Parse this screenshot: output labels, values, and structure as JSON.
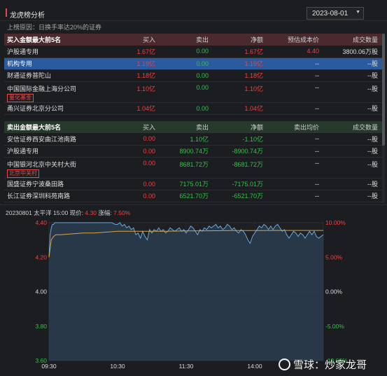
{
  "panel": {
    "title": "龙虎榜分析"
  },
  "date_picker": {
    "value": "2023-08-01"
  },
  "reason": "上榜原因：日换手率达20%的证券",
  "buy_table": {
    "headers": [
      "买入金额最大前5名",
      "买入",
      "卖出",
      "净额",
      "预估成本价",
      "成交数量"
    ],
    "rows": [
      {
        "name": "沪股通专用",
        "buy": "1.67亿",
        "sell": "0.00",
        "net": "1.67亿",
        "price": "4.40",
        "qty": "3800.06万股",
        "tag": "",
        "selected": false
      },
      {
        "name": "机构专用",
        "buy": "1.19亿",
        "sell": "0.00",
        "net": "1.19亿",
        "price": "--",
        "qty": "--股",
        "tag": "",
        "selected": true
      },
      {
        "name": "财通证券普陀山",
        "buy": "1.18亿",
        "sell": "0.00",
        "net": "1.18亿",
        "price": "--",
        "qty": "--股",
        "tag": "",
        "selected": false
      },
      {
        "name": "中国国际金融上海分公司",
        "buy": "1.10亿",
        "sell": "0.00",
        "net": "1.10亿",
        "price": "--",
        "qty": "--股",
        "tag": "量化基金",
        "selected": false
      },
      {
        "name": "甬兴证券北京分公司",
        "buy": "1.04亿",
        "sell": "0.00",
        "net": "1.04亿",
        "price": "--",
        "qty": "--股",
        "tag": "",
        "selected": false
      }
    ]
  },
  "sell_table": {
    "headers": [
      "卖出金额最大前5名",
      "买入",
      "卖出",
      "净额",
      "卖出均价",
      "成交数量"
    ],
    "rows": [
      {
        "name": "安信证券西安曲江池南路",
        "buy": "0.00",
        "sell": "1.10亿",
        "net": "-1.10亿",
        "price": "--",
        "qty": "--股",
        "tag": ""
      },
      {
        "name": "沪股通专用",
        "buy": "0.00",
        "sell": "8900.74万",
        "net": "-8900.74万",
        "price": "--",
        "qty": "--股",
        "tag": ""
      },
      {
        "name": "中国银河北京中关村大街",
        "buy": "0.00",
        "sell": "8681.72万",
        "net": "-8681.72万",
        "price": "--",
        "qty": "--股",
        "tag": "北京中关村"
      },
      {
        "name": "国盛证券宁波桑田路",
        "buy": "0.00",
        "sell": "7175.01万",
        "net": "-7175.01万",
        "price": "--",
        "qty": "--股",
        "tag": ""
      },
      {
        "name": "长江证券深圳科苑南路",
        "buy": "0.00",
        "sell": "6521.70万",
        "net": "-6521.70万",
        "price": "--",
        "qty": "--股",
        "tag": ""
      }
    ]
  },
  "quote_bar": {
    "prefix": "20230801 太平洋 15:00 现价:",
    "price": "4.30",
    "change_label": "涨幅:",
    "change": "7.50%"
  },
  "chart_data": {
    "type": "line",
    "ylim": [
      3.6,
      4.4
    ],
    "y_ticks_left": [
      "4.40",
      "4.20",
      "4.00",
      "3.80",
      "3.60"
    ],
    "y_ticks_right": [
      "10.00%",
      "5.00%",
      "0.00%",
      "-5.00%",
      "-10.00%"
    ],
    "x_ticks": [
      "09:30",
      "10:30",
      "11:30",
      "14:00"
    ],
    "x_range": [
      0,
      240
    ],
    "x_tick_positions": [
      0,
      60,
      120,
      180
    ],
    "series": [
      {
        "color": "#6aa6d8",
        "fill": true,
        "x": [
          0,
          1,
          2,
          3,
          4,
          5,
          6,
          8,
          10,
          15,
          20,
          25,
          30,
          35,
          40,
          45,
          50,
          55,
          58,
          60,
          62,
          64,
          66,
          68,
          70,
          72,
          74,
          76,
          78,
          80,
          82,
          84,
          86,
          88,
          90,
          92,
          94,
          96,
          98,
          100,
          102,
          104,
          106,
          108,
          110,
          112,
          114,
          116,
          118,
          120,
          122,
          124,
          126,
          128,
          130,
          132,
          134,
          136,
          138,
          140,
          142,
          144,
          146,
          148,
          150,
          152,
          154,
          156,
          158,
          160,
          162,
          164,
          166,
          168,
          170,
          172,
          174,
          176,
          178,
          180,
          182,
          184,
          186,
          188,
          190,
          192,
          194,
          196,
          198,
          200,
          202,
          204,
          206,
          208,
          210,
          212,
          214,
          216,
          218,
          220,
          222,
          224,
          226,
          228,
          230,
          232,
          234,
          236,
          238,
          240
        ],
        "values": [
          4.2,
          4.33,
          4.37,
          4.39,
          4.39,
          4.4,
          4.4,
          4.4,
          4.4,
          4.4,
          4.4,
          4.4,
          4.4,
          4.4,
          4.4,
          4.4,
          4.4,
          4.4,
          4.39,
          4.39,
          4.4,
          4.38,
          4.39,
          4.37,
          4.38,
          4.36,
          4.37,
          4.33,
          4.34,
          4.31,
          4.35,
          4.32,
          4.3,
          4.36,
          4.34,
          4.36,
          4.35,
          4.37,
          4.35,
          4.36,
          4.34,
          4.35,
          4.37,
          4.36,
          4.35,
          4.36,
          4.37,
          4.35,
          4.36,
          4.34,
          4.36,
          4.38,
          4.37,
          4.35,
          4.33,
          4.36,
          4.35,
          4.37,
          4.36,
          4.38,
          4.37,
          4.38,
          4.39,
          4.37,
          4.38,
          4.36,
          4.37,
          4.39,
          4.38,
          4.36,
          4.37,
          4.35,
          4.34,
          4.36,
          4.35,
          4.33,
          4.3,
          4.28,
          4.32,
          4.34,
          4.36,
          4.38,
          4.37,
          4.39,
          4.38,
          4.36,
          4.38,
          4.36,
          4.38,
          4.39,
          4.37,
          4.35,
          4.36,
          4.33,
          4.31,
          4.33,
          4.35,
          4.34,
          4.32,
          4.34,
          4.33,
          4.31,
          4.33,
          4.35,
          4.33,
          4.35,
          4.32,
          4.31,
          4.32,
          4.33
        ]
      },
      {
        "color": "#d9a441",
        "fill": false,
        "x": [
          0,
          2,
          4,
          6,
          10,
          20,
          30,
          40,
          50,
          60,
          80,
          100,
          120,
          140,
          160,
          180,
          200,
          220,
          240
        ],
        "values": [
          4.2,
          4.3,
          4.32,
          4.33,
          4.33,
          4.335,
          4.34,
          4.34,
          4.345,
          4.35,
          4.35,
          4.35,
          4.352,
          4.353,
          4.354,
          4.354,
          4.355,
          4.355,
          4.355
        ]
      }
    ],
    "ref_line": 4.0,
    "left_tick_colors": [
      "#ff3b3b",
      "#ff3b3b",
      "#dcdcdc",
      "#31c24a",
      "#31c24a"
    ],
    "right_tick_colors": [
      "#ff3b3b",
      "#ff3b3b",
      "#dcdcdc",
      "#31c24a",
      "#31c24a"
    ]
  },
  "watermark": {
    "text": "雪球：炒家龙哥"
  }
}
